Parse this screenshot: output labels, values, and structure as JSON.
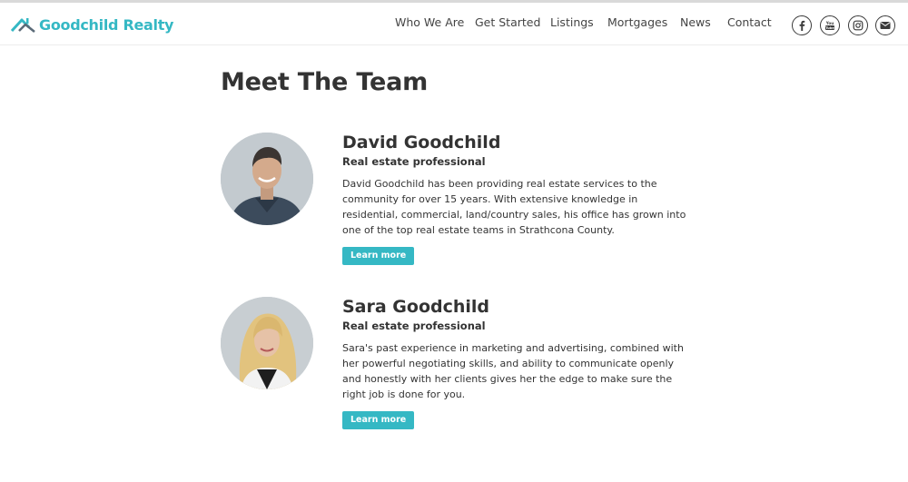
{
  "brand": {
    "name": "Goodchild Realty",
    "logo_icon": "house-roof-icon",
    "accent": "#35b8c4"
  },
  "nav": {
    "items": [
      {
        "label": "Who We Are"
      },
      {
        "label": "Get Started"
      },
      {
        "label": "Listings"
      },
      {
        "label": "Mortgages"
      },
      {
        "label": "News"
      },
      {
        "label": "Contact"
      }
    ]
  },
  "social": [
    {
      "icon": "facebook-icon"
    },
    {
      "icon": "youtube-icon"
    },
    {
      "icon": "instagram-icon"
    },
    {
      "icon": "email-icon"
    }
  ],
  "page": {
    "title": "Meet The Team"
  },
  "team": [
    {
      "name": "David Goodchild",
      "role": "Real estate professional",
      "bio": "David Goodchild has been providing real estate services to the community for over 15 years. With extensive knowledge in residential, commercial, land/country sales, his office has grown into one of the top real estate teams in Strathcona County.",
      "button": "Learn more"
    },
    {
      "name": "Sara Goodchild",
      "role": "Real estate professional",
      "bio": "Sara's past experience in marketing and advertising, combined with her powerful negotiating skills, and ability to communicate openly and honestly with her clients gives her the edge to make sure the right job is done for you.",
      "button": "Learn more"
    }
  ]
}
